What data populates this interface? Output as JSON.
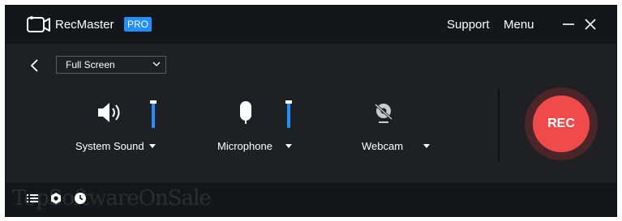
{
  "app": {
    "title": "RecMaster",
    "badge": "PRO"
  },
  "titlebar": {
    "support_label": "Support",
    "menu_label": "Menu"
  },
  "toolbar": {
    "mode_value": "Full Screen"
  },
  "sources": {
    "system_sound": {
      "label": "System Sound",
      "volume_percent": 95
    },
    "microphone": {
      "label": "Microphone",
      "volume_percent": 95
    },
    "webcam": {
      "label": "Webcam",
      "enabled": false
    }
  },
  "record": {
    "label": "REC"
  },
  "watermark": {
    "text": "TopSoftwareOnSale"
  },
  "colors": {
    "accent": "#1e90ff",
    "rec": "#f04a4a",
    "window_bg": "#1f2024",
    "bar_bg": "#15161a"
  }
}
